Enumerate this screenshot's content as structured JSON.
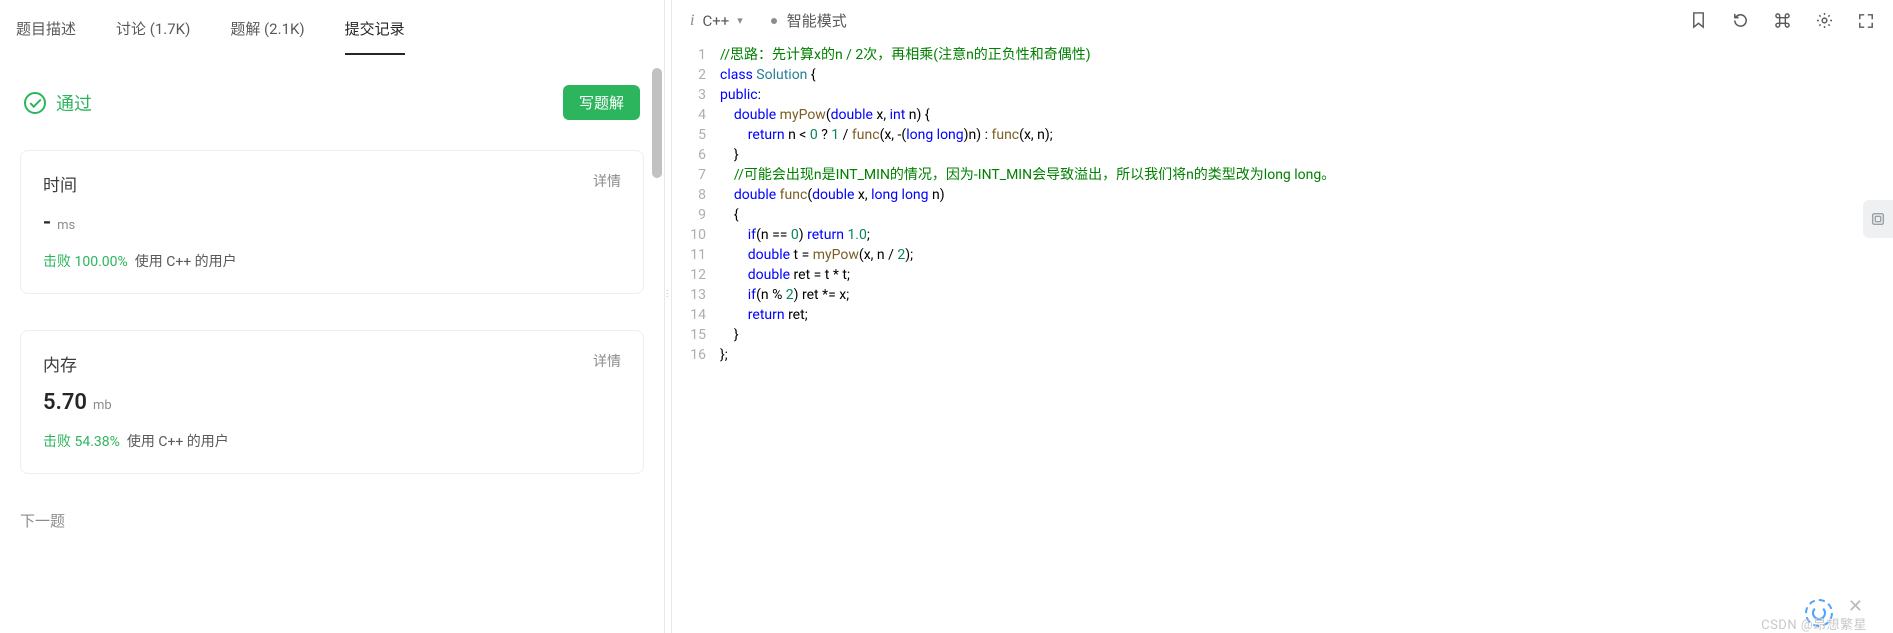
{
  "tabs": {
    "desc": "题目描述",
    "discuss": "讨论 (1.7K)",
    "solutions": "题解 (2.1K)",
    "submissions": "提交记录"
  },
  "result": {
    "status": "通过",
    "write_solution": "写题解"
  },
  "time_card": {
    "title": "时间",
    "detail": "详情",
    "value": "-",
    "unit": "ms",
    "beat_prefix": "击败",
    "beat_pct": "100.00%",
    "beat_suffix": "使用 C++ 的用户"
  },
  "mem_card": {
    "title": "内存",
    "detail": "详情",
    "value": "5.70",
    "unit": "mb",
    "beat_prefix": "击败",
    "beat_pct": "54.38%",
    "beat_suffix": "使用 C++ 的用户"
  },
  "next": "下一题",
  "editor": {
    "lang": "C++",
    "mode": "智能模式"
  },
  "code_lines": [
    [
      [
        "c-comment",
        "//思路：先计算x的n / 2次，再相乘(注意n的正负性和奇偶性)"
      ]
    ],
    [
      [
        "c-kw",
        "class"
      ],
      [
        "c-id",
        " "
      ],
      [
        "c-cls",
        "Solution"
      ],
      [
        "c-id",
        " "
      ],
      [
        "c-punc",
        "{"
      ]
    ],
    [
      [
        "c-kw",
        "public"
      ],
      [
        "c-punc",
        ":"
      ]
    ],
    [
      [
        "c-id",
        "    "
      ],
      [
        "c-type",
        "double"
      ],
      [
        "c-id",
        " "
      ],
      [
        "c-fn",
        "myPow"
      ],
      [
        "c-punc",
        "("
      ],
      [
        "c-type",
        "double"
      ],
      [
        "c-id",
        " x, "
      ],
      [
        "c-type",
        "int"
      ],
      [
        "c-id",
        " n"
      ],
      [
        "c-punc",
        ")"
      ],
      [
        "c-id",
        " "
      ],
      [
        "c-punc",
        "{"
      ]
    ],
    [
      [
        "c-id",
        "        "
      ],
      [
        "c-kw",
        "return"
      ],
      [
        "c-id",
        " n < "
      ],
      [
        "c-num",
        "0"
      ],
      [
        "c-id",
        " ? "
      ],
      [
        "c-num",
        "1"
      ],
      [
        "c-id",
        " / "
      ],
      [
        "c-fn",
        "func"
      ],
      [
        "c-punc",
        "("
      ],
      [
        "c-id",
        "x, -"
      ],
      [
        "c-punc",
        "("
      ],
      [
        "c-type",
        "long"
      ],
      [
        "c-id",
        " "
      ],
      [
        "c-type",
        "long"
      ],
      [
        "c-punc",
        ")"
      ],
      [
        "c-id",
        "n"
      ],
      [
        "c-punc",
        ")"
      ],
      [
        "c-id",
        " : "
      ],
      [
        "c-fn",
        "func"
      ],
      [
        "c-punc",
        "("
      ],
      [
        "c-id",
        "x, n"
      ],
      [
        "c-punc",
        ")"
      ],
      [
        "c-punc",
        ";"
      ]
    ],
    [
      [
        "c-id",
        "    "
      ],
      [
        "c-punc",
        "}"
      ]
    ],
    [
      [
        "c-id",
        "    "
      ],
      [
        "c-comment",
        "//可能会出现n是INT_MIN的情况，因为-INT_MIN会导致溢出，所以我们将n的类型改为long long。"
      ]
    ],
    [
      [
        "c-id",
        "    "
      ],
      [
        "c-type",
        "double"
      ],
      [
        "c-id",
        " "
      ],
      [
        "c-fn",
        "func"
      ],
      [
        "c-punc",
        "("
      ],
      [
        "c-type",
        "double"
      ],
      [
        "c-id",
        " x, "
      ],
      [
        "c-type",
        "long"
      ],
      [
        "c-id",
        " "
      ],
      [
        "c-type",
        "long"
      ],
      [
        "c-id",
        " n"
      ],
      [
        "c-punc",
        ")"
      ]
    ],
    [
      [
        "c-id",
        "    "
      ],
      [
        "c-punc",
        "{"
      ]
    ],
    [
      [
        "c-id",
        "        "
      ],
      [
        "c-kw",
        "if"
      ],
      [
        "c-punc",
        "("
      ],
      [
        "c-id",
        "n == "
      ],
      [
        "c-num",
        "0"
      ],
      [
        "c-punc",
        ")"
      ],
      [
        "c-id",
        " "
      ],
      [
        "c-kw",
        "return"
      ],
      [
        "c-id",
        " "
      ],
      [
        "c-num",
        "1.0"
      ],
      [
        "c-punc",
        ";"
      ]
    ],
    [
      [
        "c-id",
        "        "
      ],
      [
        "c-type",
        "double"
      ],
      [
        "c-id",
        " t = "
      ],
      [
        "c-fn",
        "myPow"
      ],
      [
        "c-punc",
        "("
      ],
      [
        "c-id",
        "x, n / "
      ],
      [
        "c-num",
        "2"
      ],
      [
        "c-punc",
        ")"
      ],
      [
        "c-punc",
        ";"
      ]
    ],
    [
      [
        "c-id",
        "        "
      ],
      [
        "c-type",
        "double"
      ],
      [
        "c-id",
        " ret = t * t"
      ],
      [
        "c-punc",
        ";"
      ]
    ],
    [
      [
        "c-id",
        "        "
      ],
      [
        "c-kw",
        "if"
      ],
      [
        "c-punc",
        "("
      ],
      [
        "c-id",
        "n % "
      ],
      [
        "c-num",
        "2"
      ],
      [
        "c-punc",
        ")"
      ],
      [
        "c-id",
        " ret *= x"
      ],
      [
        "c-punc",
        ";"
      ]
    ],
    [
      [
        "c-id",
        "        "
      ],
      [
        "c-kw",
        "return"
      ],
      [
        "c-id",
        " ret"
      ],
      [
        "c-punc",
        ";"
      ]
    ],
    [
      [
        "c-id",
        "    "
      ],
      [
        "c-punc",
        "}"
      ]
    ],
    [
      [
        "c-punc",
        "};"
      ]
    ]
  ],
  "watermark": "CSDN @昂想繁星"
}
